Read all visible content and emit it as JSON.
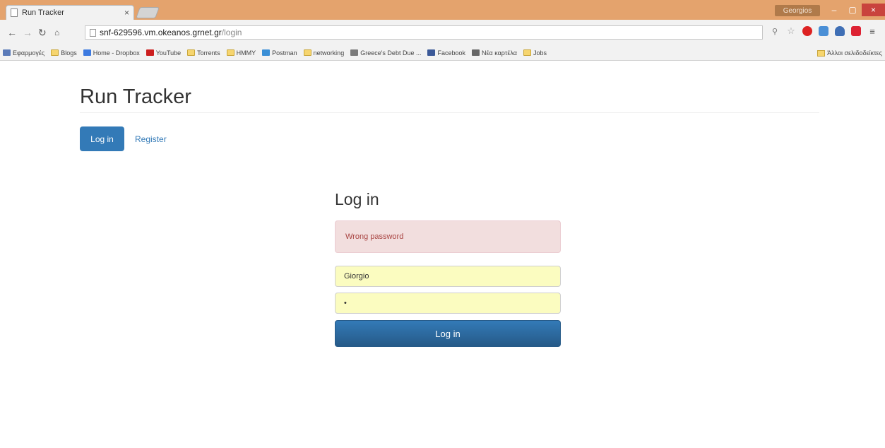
{
  "browser": {
    "tab_title": "Run Tracker",
    "tab_close": "×",
    "user_badge": "Georgios",
    "window_min": "–",
    "window_max": "▢",
    "window_close": "×",
    "url_host": "snf-629596.vm.okeanos.grnet.gr",
    "url_path": "/login",
    "bookmarks": [
      {
        "label": "Εφαρμογές",
        "icon": "apps-icon",
        "color": "#5a7ab8"
      },
      {
        "label": "Blogs",
        "icon": "folder-icon",
        "color": "#f6d56f"
      },
      {
        "label": "Home - Dropbox",
        "icon": "dropbox-icon",
        "color": "#3d7ae0"
      },
      {
        "label": "YouTube",
        "icon": "youtube-icon",
        "color": "#cc1e1e"
      },
      {
        "label": "Torrents",
        "icon": "folder-icon",
        "color": "#f6d56f"
      },
      {
        "label": "HMMY",
        "icon": "folder-icon",
        "color": "#f6d56f"
      },
      {
        "label": "Postman",
        "icon": "postman-icon",
        "color": "#3a8fd6"
      },
      {
        "label": "networking",
        "icon": "folder-icon",
        "color": "#f6d56f"
      },
      {
        "label": "Greece's Debt Due ...",
        "icon": "page-icon",
        "color": "#7a7a7a"
      },
      {
        "label": "Facebook",
        "icon": "facebook-icon",
        "color": "#3b5998"
      },
      {
        "label": "Νέα καρτέλα",
        "icon": "newtab-icon",
        "color": "#666666"
      },
      {
        "label": "Jobs",
        "icon": "folder-icon",
        "color": "#f6d56f"
      }
    ],
    "other_bookmarks": "Άλλοι σελιδοδείκτες"
  },
  "page": {
    "site_title": "Run Tracker",
    "nav": {
      "login_label": "Log in",
      "register_label": "Register"
    },
    "form": {
      "heading": "Log in",
      "alert_text": "Wrong password",
      "username_value": "Giorgio",
      "password_value": "•",
      "submit_label": "Log in"
    }
  },
  "colors": {
    "primary": "#337ab7",
    "alert_bg": "#f2dede",
    "alert_text": "#a94442",
    "autofill_bg": "#fbfcc0",
    "titlebar": "#e4a36d"
  }
}
